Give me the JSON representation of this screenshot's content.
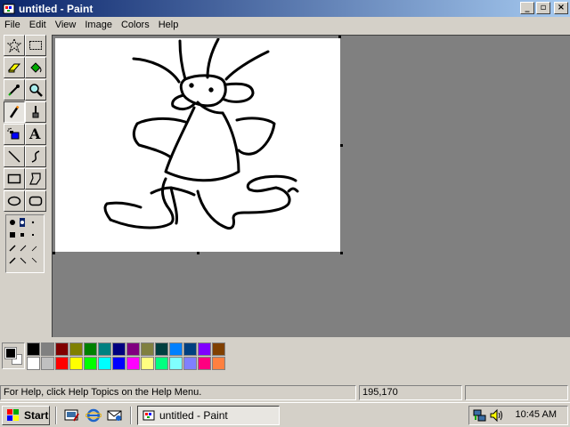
{
  "window": {
    "title": "untitled - Paint"
  },
  "titlebar_buttons": {
    "minimize": "_",
    "maximize": "▫",
    "close": "×"
  },
  "menu": [
    "File",
    "Edit",
    "View",
    "Image",
    "Colors",
    "Help"
  ],
  "tools": [
    {
      "name": "free-form-select",
      "icon": "star-select-icon"
    },
    {
      "name": "select",
      "icon": "rect-select-icon"
    },
    {
      "name": "eraser",
      "icon": "eraser-icon"
    },
    {
      "name": "fill",
      "icon": "bucket-icon"
    },
    {
      "name": "pick-color",
      "icon": "eyedropper-icon"
    },
    {
      "name": "magnifier",
      "icon": "magnifier-icon"
    },
    {
      "name": "pencil",
      "icon": "pencil-icon",
      "active": true
    },
    {
      "name": "brush",
      "icon": "brush-icon"
    },
    {
      "name": "airbrush",
      "icon": "airbrush-icon"
    },
    {
      "name": "text",
      "icon": "text-icon",
      "glyph": "A"
    },
    {
      "name": "line",
      "icon": "line-icon"
    },
    {
      "name": "curve",
      "icon": "curve-icon"
    },
    {
      "name": "rectangle",
      "icon": "rectangle-icon"
    },
    {
      "name": "polygon",
      "icon": "polygon-icon"
    },
    {
      "name": "ellipse",
      "icon": "ellipse-icon"
    },
    {
      "name": "rounded-rectangle",
      "icon": "rounded-rect-icon"
    }
  ],
  "palette": {
    "foreground": "#000000",
    "background": "#ffffff",
    "row1": [
      "#000000",
      "#808080",
      "#800000",
      "#808000",
      "#008000",
      "#008080",
      "#000080",
      "#800080",
      "#808040",
      "#004040",
      "#0080ff",
      "#004080",
      "#8000ff",
      "#804000"
    ],
    "row2": [
      "#ffffff",
      "#c0c0c0",
      "#ff0000",
      "#ffff00",
      "#00ff00",
      "#00ffff",
      "#0000ff",
      "#ff00ff",
      "#ffff80",
      "#00ff80",
      "#80ffff",
      "#8080ff",
      "#ff0080",
      "#ff8040"
    ]
  },
  "status": {
    "help": "For Help, click Help Topics on the Help Menu.",
    "coords": "195,170",
    "size": ""
  },
  "taskbar": {
    "start_label": "Start",
    "task_label": "untitled - Paint",
    "clock": "10:45 AM"
  }
}
